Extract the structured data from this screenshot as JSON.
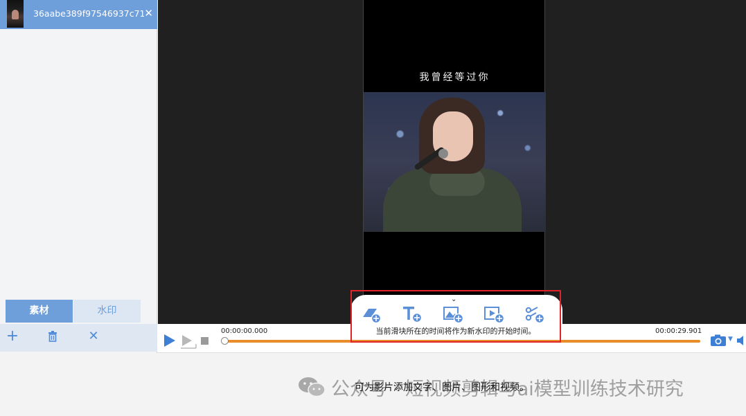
{
  "file_list": {
    "items": [
      {
        "name": "36aabe389f97546937c71..."
      }
    ]
  },
  "tabs": [
    {
      "label": "素材",
      "active": true
    },
    {
      "label": "水印",
      "active": false
    }
  ],
  "left_toolbar": {
    "add_icon": "plus-icon",
    "delete_icon": "trash-icon",
    "clear_icon": "close-icon"
  },
  "preview": {
    "caption": "我曾经等过你"
  },
  "watermark_toolbar": {
    "buttons": [
      {
        "icon": "add-shape-icon"
      },
      {
        "icon": "add-text-icon"
      },
      {
        "icon": "add-image-icon"
      },
      {
        "icon": "add-video-icon"
      },
      {
        "icon": "add-effect-icon"
      }
    ],
    "hint": "当前滑块所在的时间将作为新水印的开始时间。"
  },
  "timeline": {
    "start_time": "00:00:00.000",
    "end_time": "00:00:29.901",
    "progress": 0
  },
  "status": {
    "text": "可为影片添加文字、图片、图形和视频。"
  },
  "overlay_watermark": {
    "text": "公众号 · 短视频剪辑与ai模型训练技术研究"
  },
  "colors": {
    "accent": "#6e9fdb",
    "highlight": "#e0242a",
    "timeline": "#e98c2c"
  }
}
